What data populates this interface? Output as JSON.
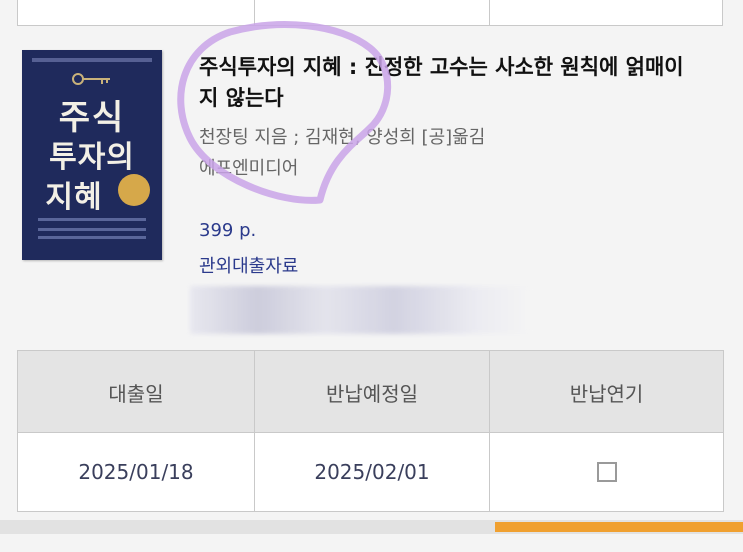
{
  "book": {
    "title": "주식투자의 지혜 : 진정한 고수는 사소한 원칙에 얽매이지 않는다",
    "author": "천장팅 지음 ; 김재현, 양성희 [공]옮김",
    "publisher": "에프엔미디어",
    "pages": "399 p.",
    "loan_type": "관외대출자료",
    "cover": {
      "title_lines": [
        "주식",
        "투자의",
        "지혜"
      ],
      "colors": {
        "background": "#1f2a5c",
        "text": "#f3f0e6",
        "seal": "#d6a84a"
      }
    }
  },
  "loan_table": {
    "headers": [
      "대출일",
      "반납예정일",
      "반납연기"
    ],
    "rows": [
      {
        "loan_date": "2025/01/18",
        "due_date": "2025/02/01",
        "extend_checked": false
      }
    ]
  },
  "colors": {
    "accent": "#2b3a8c",
    "highlight": "#c9a3e8",
    "progress": "#f0a030"
  },
  "icons": {
    "extend_checkbox": "checkbox-icon",
    "cover_key": "key-icon"
  }
}
